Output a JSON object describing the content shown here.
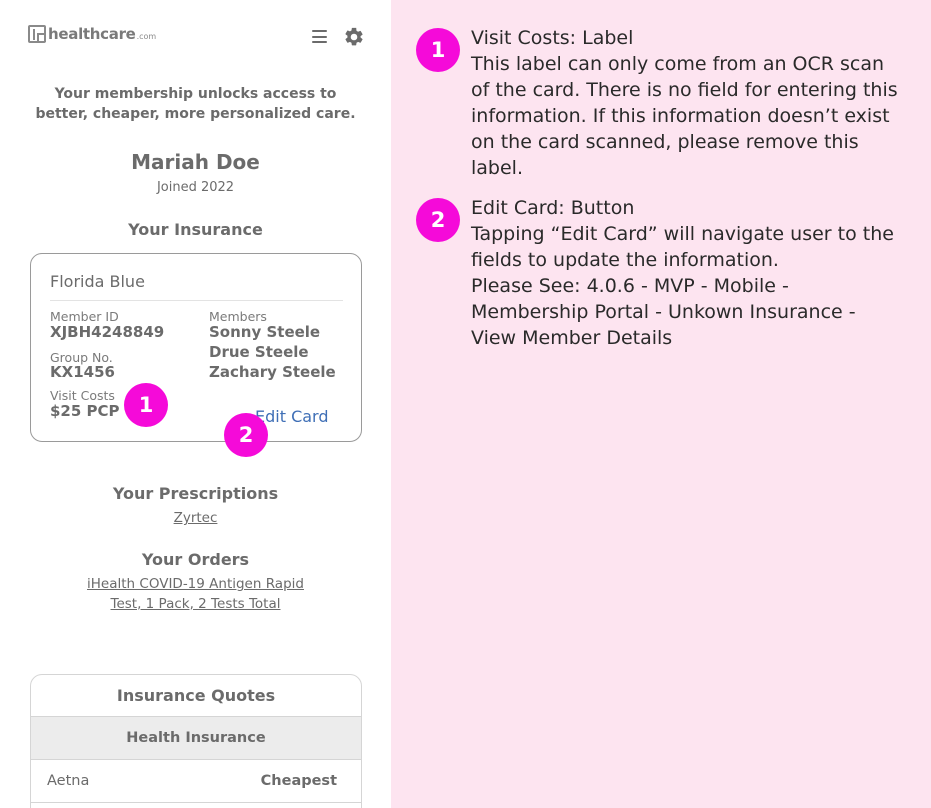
{
  "header": {
    "logo_text": "healthcare",
    "logo_suffix": ".com",
    "menu_icon": "hamburger-menu-icon",
    "settings_icon": "gear-icon"
  },
  "intro": {
    "tagline": "Your membership unlocks access to better, cheaper, more personalized care.",
    "member_name": "Mariah Doe",
    "joined": "Joined 2022"
  },
  "insurance": {
    "section_title": "Your Insurance",
    "carrier": "Florida Blue",
    "member_id_label": "Member ID",
    "member_id": "XJBH4248849",
    "group_label": "Group No.",
    "group_no": "KX1456",
    "visit_costs_label": "Visit Costs",
    "visit_costs": "$25 PCP",
    "members_label": "Members",
    "members": [
      "Sonny Steele",
      "Drue Steele",
      "Zachary Steele"
    ],
    "edit_card_label": "Edit Card"
  },
  "prescriptions": {
    "section_title": "Your Prescriptions",
    "items": [
      "Zyrtec"
    ]
  },
  "orders": {
    "section_title": "Your Orders",
    "items": [
      "iHealth COVID-19 Antigen Rapid",
      "Test, 1 Pack, 2 Tests Total"
    ]
  },
  "quotes": {
    "title": "Insurance Quotes",
    "subtitle": "Health Insurance",
    "rows": [
      {
        "provider": "Aetna",
        "tag": "Cheapest"
      }
    ]
  },
  "markers": [
    "1",
    "2"
  ],
  "annotations": [
    {
      "number": "1",
      "title": "Visit Costs: Label",
      "body": "This label can only come from an OCR scan of the card. There is no field for entering this information. If this information doesn’t exist on the card scanned, please remove this label."
    },
    {
      "number": "2",
      "title": "Edit Card: Button",
      "body": "Tapping “Edit Card” will navigate user to the fields to update the information.\nPlease See: 4.0.6 - MVP - Mobile - Membership Portal - Unkown Insurance - View Member Details"
    }
  ],
  "colors": {
    "annotation_bg": "#fde4f0",
    "marker": "#f50ad9",
    "link_blue": "#3f6fb6",
    "text_gray": "#6b6b6b"
  }
}
